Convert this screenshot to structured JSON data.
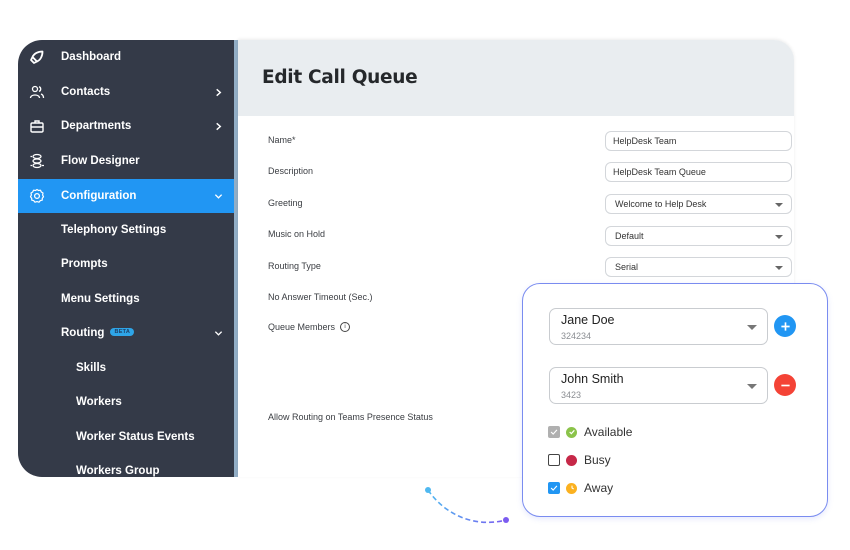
{
  "sidebar": {
    "items": [
      {
        "label": "Dashboard",
        "icon": "rocket-icon"
      },
      {
        "label": "Contacts",
        "icon": "users-icon"
      },
      {
        "label": "Departments",
        "icon": "briefcase-icon"
      },
      {
        "label": "Flow Designer",
        "icon": "flow-icon"
      },
      {
        "label": "Configuration",
        "icon": "gear-icon"
      }
    ],
    "sub_items": [
      {
        "label": "Telephony Settings"
      },
      {
        "label": "Prompts"
      },
      {
        "label": "Menu Settings"
      },
      {
        "label": "Routing",
        "badge": "BETA"
      }
    ],
    "routing_items": [
      {
        "label": "Skills"
      },
      {
        "label": "Workers"
      },
      {
        "label": "Worker Status Events"
      },
      {
        "label": "Workers Group"
      }
    ],
    "active_color": "#2196f3"
  },
  "main": {
    "title": "Edit Call Queue",
    "fields": [
      {
        "label": "Name*",
        "value": "HelpDesk Team",
        "type": "text"
      },
      {
        "label": "Description",
        "value": "HelpDesk Team Queue",
        "type": "text"
      },
      {
        "label": "Greeting",
        "value": "Welcome to Help Desk",
        "type": "select"
      },
      {
        "label": "Music on Hold",
        "value": "Default",
        "type": "select"
      },
      {
        "label": "Routing Type",
        "value": "Serial",
        "type": "select"
      },
      {
        "label": "No Answer Timeout (Sec.)"
      },
      {
        "label": "Queue Members",
        "info_icon": "info-icon"
      },
      {
        "label": "Allow Routing on Teams Presence Status"
      }
    ]
  },
  "queue_card": {
    "members": [
      {
        "name": "Jane Doe",
        "id": "324234",
        "action": "add"
      },
      {
        "name": "John Smith",
        "id": "3423",
        "action": "remove"
      }
    ],
    "statuses": [
      {
        "label": "Available",
        "state": "checked-disabled",
        "color": "#8bc34a",
        "icon": "check-circle-icon"
      },
      {
        "label": "Busy",
        "state": "unchecked",
        "color": "#c62848",
        "icon": "dot-icon"
      },
      {
        "label": "Away",
        "state": "checked",
        "color": "#fbb120",
        "icon": "clock-icon"
      }
    ]
  }
}
